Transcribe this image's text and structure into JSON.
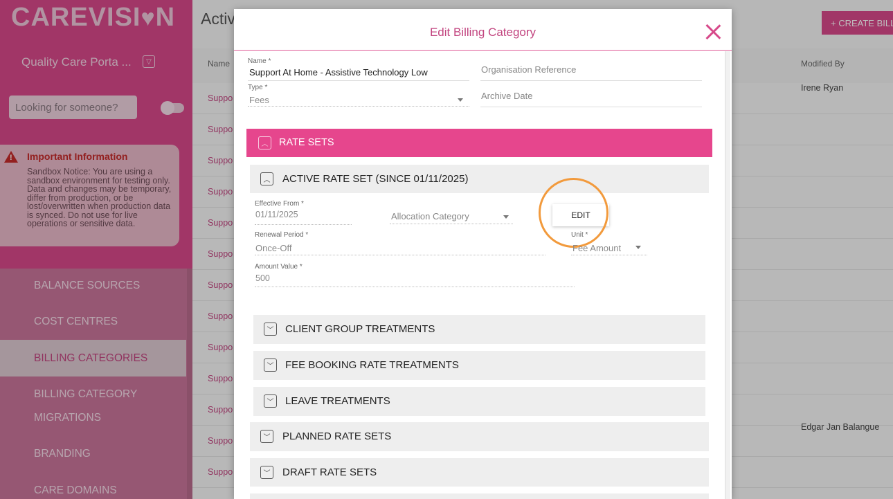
{
  "brand": {
    "logo_text": "CAREVISI",
    "logo_heart": "♥",
    "logo_end": "N"
  },
  "sidebar": {
    "org_name": "Quality Care Porta ...",
    "search_placeholder": "Looking for someone?",
    "info_title": "Important Information",
    "info_text": "Sandbox Notice: You are using a sandbox environment for testing only. Data and changes may be temporary, differ from production, or be lost/overwritten when production data is synced. Do not use for live operations or sensitive data.",
    "nav_items": [
      "BALANCE SOURCES",
      "COST CENTRES",
      "BILLING CATEGORIES",
      "BILLING CATEGORY",
      "MIGRATIONS",
      "BRANDING",
      "CARE DOMAINS"
    ]
  },
  "page": {
    "title": "Activ",
    "create_label": "+ CREATE BILLI",
    "columns": {
      "name": "Name",
      "modified_by": "Modified By"
    },
    "rows": [
      {
        "name": "Suppo",
        "modified_by": "Irene Ryan"
      },
      {
        "name": "Suppo",
        "modified_by": ""
      },
      {
        "name": "Suppo",
        "modified_by": ""
      },
      {
        "name": "Suppo",
        "modified_by": ""
      },
      {
        "name": "Suppo",
        "modified_by": ""
      },
      {
        "name": "Suppo",
        "modified_by": ""
      },
      {
        "name": "Suppo",
        "modified_by": ""
      },
      {
        "name": "Suppo",
        "modified_by": ""
      },
      {
        "name": "Suppo",
        "modified_by": ""
      },
      {
        "name": "Suppo",
        "modified_by": ""
      },
      {
        "name": "Suppo",
        "modified_by": ""
      },
      {
        "name": "Suppo",
        "modified_by": "Edgar Jan Balangue"
      },
      {
        "name": "Suppo",
        "modified_by": ""
      },
      {
        "name": "Suppo",
        "modified_by": ""
      }
    ]
  },
  "modal": {
    "title": "Edit Billing Category",
    "name_label": "Name *",
    "name_value": "Support At Home - Assistive Technology Low",
    "org_ref_placeholder": "Organisation Reference",
    "type_label": "Type *",
    "type_value": "Fees",
    "archive_placeholder": "Archive Date",
    "rate_sets_label": "RATE SETS",
    "active_rate_set_label": "ACTIVE RATE SET (SINCE 01/11/2025)",
    "effective_from_label": "Effective From *",
    "effective_from_value": "01/11/2025",
    "allocation_placeholder": "Allocation Category",
    "edit_label": "EDIT",
    "renewal_label": "Renewal Period *",
    "renewal_value": "Once-Off",
    "unit_label": "Unit *",
    "unit_value": "Fee Amount",
    "amount_label": "Amount Value *",
    "amount_value": "500",
    "sections": {
      "client_group": "CLIENT GROUP TREATMENTS",
      "fee_booking": "FEE BOOKING RATE TREATMENTS",
      "leave": "LEAVE TREATMENTS",
      "planned": "PLANNED RATE SETS",
      "draft": "DRAFT RATE SETS"
    }
  },
  "colors": {
    "brand_pink": "#d7498a",
    "rate_bar": "#e6468d",
    "highlight": "#f29a3c",
    "warning": "#c42a2a"
  }
}
